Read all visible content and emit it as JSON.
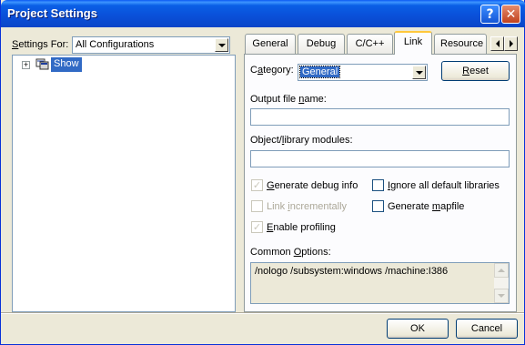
{
  "window": {
    "title": "Project Settings",
    "help_glyph": "?",
    "close_glyph": "✕"
  },
  "left": {
    "settings_for_label_pre": "",
    "settings_for_label_u": "S",
    "settings_for_label_post": "ettings For:",
    "configuration": "All Configurations",
    "tree": {
      "expander_glyph": "+",
      "item": "Show"
    }
  },
  "tabs": [
    {
      "label": "General"
    },
    {
      "label": "Debug"
    },
    {
      "label": "C/C++"
    },
    {
      "label": "Link"
    },
    {
      "label": "Resource"
    }
  ],
  "active_tab": "Link",
  "link": {
    "category_label_pre": "C",
    "category_label_u": "a",
    "category_label_post": "tegory:",
    "category_value": "General",
    "reset_pre": "",
    "reset_u": "R",
    "reset_post": "eset",
    "output_label_pre": "Output file ",
    "output_label_u": "n",
    "output_label_post": "ame:",
    "output_value": "",
    "modules_label_pre": "Object/",
    "modules_label_u": "l",
    "modules_label_post": "ibrary modules:",
    "modules_value": "",
    "checkboxes": {
      "generate_debug": {
        "pre": "",
        "u": "G",
        "post": "enerate debug info",
        "checked": true
      },
      "ignore_libs": {
        "pre": "",
        "u": "I",
        "post": "gnore all default libraries",
        "checked": false
      },
      "link_incremental": {
        "pre": "Link ",
        "u": "i",
        "post": "ncrementally",
        "checked": false
      },
      "generate_mapfile": {
        "pre": "Generate ",
        "u": "m",
        "post": "apfile",
        "checked": false
      },
      "enable_profiling": {
        "pre": "",
        "u": "E",
        "post": "nable profiling",
        "checked": true
      }
    },
    "common_options_label_pre": "Common ",
    "common_options_label_u": "O",
    "common_options_label_post": "ptions:",
    "common_options_value": "/nologo /subsystem:windows /machine:I386"
  },
  "footer": {
    "ok": "OK",
    "cancel": "Cancel"
  },
  "colors": {
    "title_bar": "#0a4fd8",
    "selection": "#316ac5",
    "tab_highlight": "#ffc83c",
    "face": "#ece9d8"
  }
}
